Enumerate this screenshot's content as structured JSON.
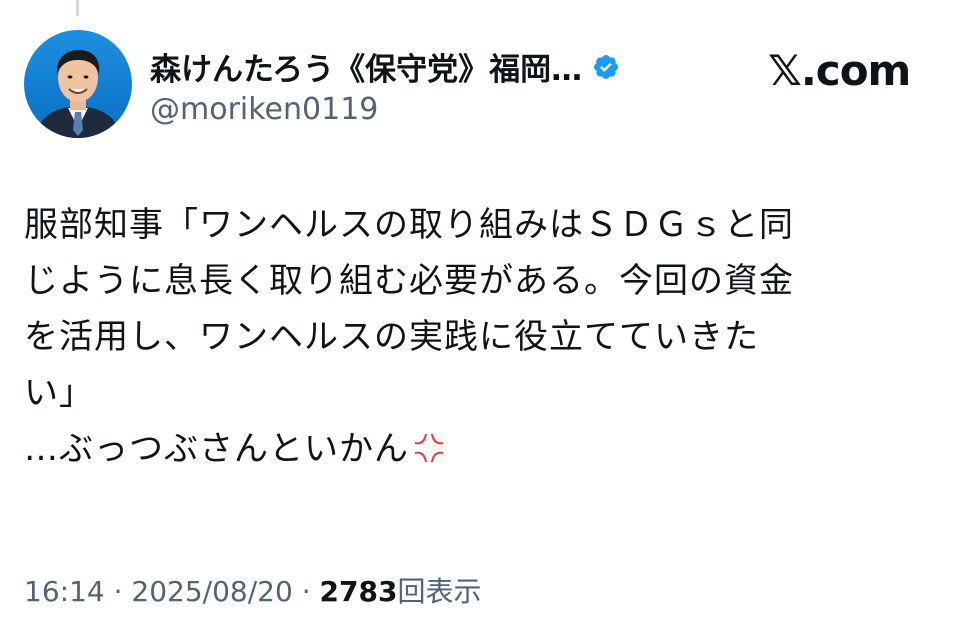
{
  "user": {
    "display_name": "森けんたろう《保守党》福岡…",
    "handle": "@moriken0119",
    "verified_icon": "verified-badge-icon",
    "avatar_icon": "profile-photo"
  },
  "brand": {
    "logo_text": "𝕏.com"
  },
  "tweet": {
    "text": "服部知事「ワンヘルスの取り組みはＳＤＧｓと同\nじように息長く取り組む必要がある。今回の資金\nを活用し、ワンヘルスの実践に役立てていきた\nい」\n…ぶっつぶさんといかん",
    "emoji": "anger-symbol-icon"
  },
  "meta": {
    "time": "16:14",
    "separator": " · ",
    "date": "2025/08/20",
    "views_count": "2783",
    "views_label": "回表示"
  },
  "colors": {
    "text": "#0f1419",
    "secondary": "#536471",
    "verified": "#1d9bf0",
    "anger": "#e53935"
  }
}
